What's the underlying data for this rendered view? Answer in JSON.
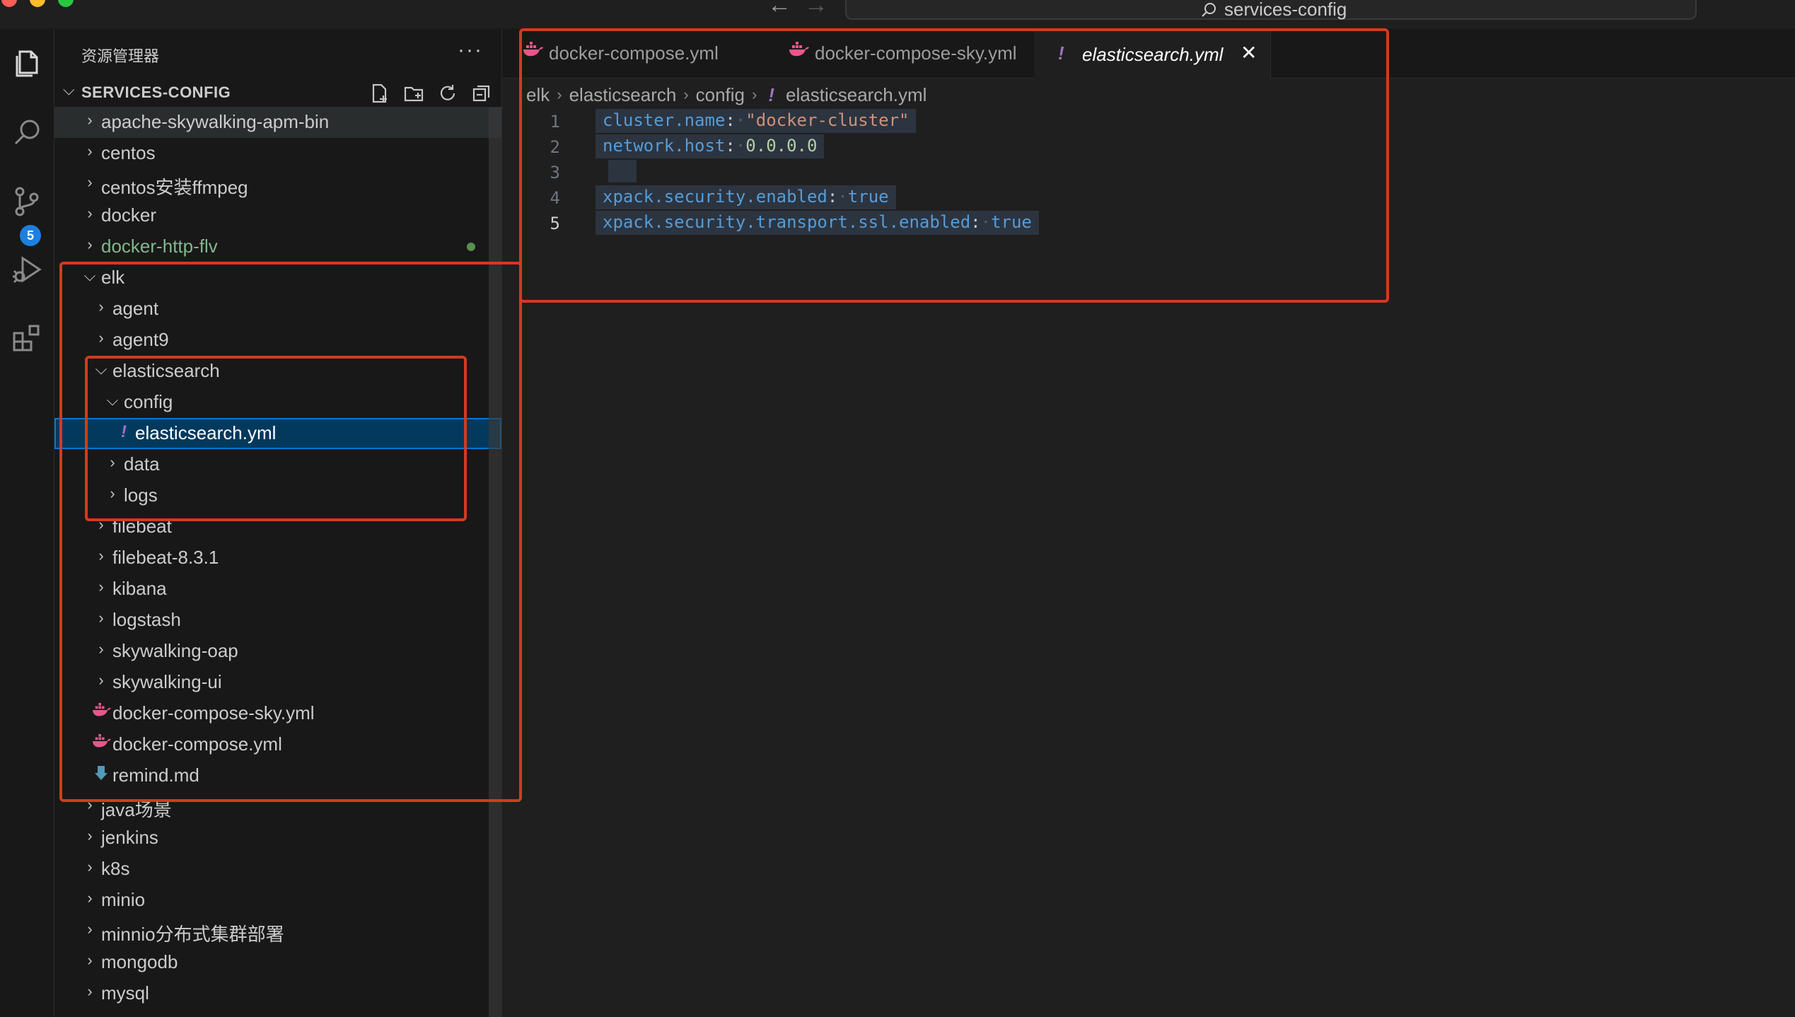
{
  "window": {
    "search_text": "services-config"
  },
  "activity_bar": {
    "items": [
      {
        "name": "explorer-icon"
      },
      {
        "name": "search-icon"
      },
      {
        "name": "source-control-icon",
        "badge": "5"
      },
      {
        "name": "run-debug-icon"
      },
      {
        "name": "extensions-icon"
      }
    ]
  },
  "sidebar": {
    "title": "资源管理器",
    "more": "···",
    "section_title": "SERVICES-CONFIG",
    "tree": [
      {
        "label": "apache-skywalking-apm-bin",
        "depth": 0,
        "type": "folder",
        "state": "collapsed"
      },
      {
        "label": "centos",
        "depth": 0,
        "type": "folder",
        "state": "collapsed"
      },
      {
        "label": "centos安装ffmpeg",
        "depth": 0,
        "type": "folder",
        "state": "collapsed"
      },
      {
        "label": "docker",
        "depth": 0,
        "type": "folder",
        "state": "collapsed"
      },
      {
        "label": "docker-http-flv",
        "depth": 0,
        "type": "folder",
        "state": "collapsed",
        "git": "modified"
      },
      {
        "label": "elk",
        "depth": 0,
        "type": "folder",
        "state": "expanded"
      },
      {
        "label": "agent",
        "depth": 1,
        "type": "folder",
        "state": "collapsed"
      },
      {
        "label": "agent9",
        "depth": 1,
        "type": "folder",
        "state": "collapsed"
      },
      {
        "label": "elasticsearch",
        "depth": 1,
        "type": "folder",
        "state": "expanded"
      },
      {
        "label": "config",
        "depth": 2,
        "type": "folder",
        "state": "expanded"
      },
      {
        "label": "elasticsearch.yml",
        "depth": 3,
        "type": "yaml",
        "selected": true
      },
      {
        "label": "data",
        "depth": 2,
        "type": "folder",
        "state": "collapsed"
      },
      {
        "label": "logs",
        "depth": 2,
        "type": "folder",
        "state": "collapsed"
      },
      {
        "label": "filebeat",
        "depth": 1,
        "type": "folder",
        "state": "collapsed"
      },
      {
        "label": "filebeat-8.3.1",
        "depth": 1,
        "type": "folder",
        "state": "collapsed"
      },
      {
        "label": "kibana",
        "depth": 1,
        "type": "folder",
        "state": "collapsed"
      },
      {
        "label": "logstash",
        "depth": 1,
        "type": "folder",
        "state": "collapsed"
      },
      {
        "label": "skywalking-oap",
        "depth": 1,
        "type": "folder",
        "state": "collapsed"
      },
      {
        "label": "skywalking-ui",
        "depth": 1,
        "type": "folder",
        "state": "collapsed"
      },
      {
        "label": "docker-compose-sky.yml",
        "depth": 1,
        "type": "docker"
      },
      {
        "label": "docker-compose.yml",
        "depth": 1,
        "type": "docker"
      },
      {
        "label": "remind.md",
        "depth": 1,
        "type": "markdown"
      },
      {
        "label": "java场景",
        "depth": 0,
        "type": "folder",
        "state": "collapsed"
      },
      {
        "label": "jenkins",
        "depth": 0,
        "type": "folder",
        "state": "collapsed"
      },
      {
        "label": "k8s",
        "depth": 0,
        "type": "folder",
        "state": "collapsed"
      },
      {
        "label": "minio",
        "depth": 0,
        "type": "folder",
        "state": "collapsed"
      },
      {
        "label": "minnio分布式集群部署",
        "depth": 0,
        "type": "folder",
        "state": "collapsed"
      },
      {
        "label": "mongodb",
        "depth": 0,
        "type": "folder",
        "state": "collapsed"
      },
      {
        "label": "mysql",
        "depth": 0,
        "type": "folder",
        "state": "collapsed"
      }
    ]
  },
  "editor": {
    "tabs": [
      {
        "label": "docker-compose.yml",
        "icon": "docker-icon",
        "active": false
      },
      {
        "label": "docker-compose-sky.yml",
        "icon": "docker-icon",
        "active": false
      },
      {
        "label": "elasticsearch.yml",
        "icon": "yaml-icon",
        "active": true,
        "close": "✕"
      }
    ],
    "breadcrumbs": [
      "elk",
      "elasticsearch",
      "config",
      "elasticsearch.yml"
    ],
    "lines": [
      {
        "num": "1",
        "key": "cluster.name",
        "value": "\"docker-cluster\"",
        "vtype": "string"
      },
      {
        "num": "2",
        "key": "network.host",
        "value": "0.0.0.0",
        "vtype": "number"
      },
      {
        "num": "3",
        "key": "",
        "value": "",
        "vtype": "empty"
      },
      {
        "num": "4",
        "key": "xpack.security.enabled",
        "value": "true",
        "vtype": "bool"
      },
      {
        "num": "5",
        "key": "xpack.security.transport.ssl.enabled",
        "value": "true",
        "vtype": "bool",
        "current": true
      }
    ]
  },
  "colors": {
    "accent": "#0078d4",
    "annotation_red": "#d43a1f",
    "git_modified_green": "#81b88b",
    "docker_icon": "#e5578b",
    "yaml_icon": "#a074c4"
  }
}
